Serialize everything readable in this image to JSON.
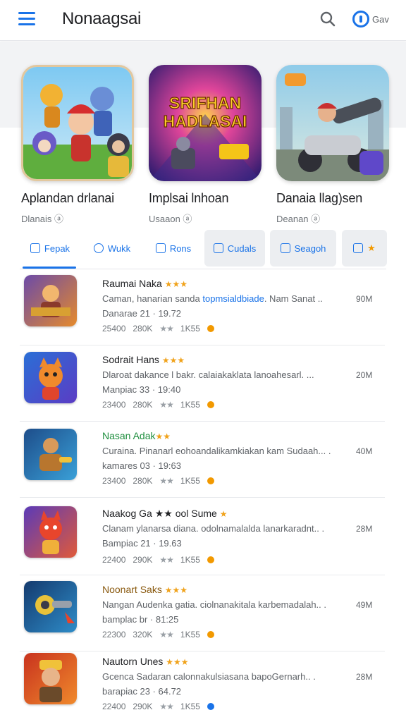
{
  "header": {
    "title": "Nonaagsai",
    "account_label": "Gav"
  },
  "featured": [
    {
      "name": "Aplandan drlanai",
      "sub": "Dlanais ⓐ",
      "art_text_1": "",
      "art_text_2": ""
    },
    {
      "name": "Implsai lnhoan",
      "sub": "Usaaon ⓐ",
      "art_text_1": "SRIFHAN",
      "art_text_2": "HADLASAI"
    },
    {
      "name": "Danaia llag)sen",
      "sub": "Deanan ⓐ",
      "art_text_1": "",
      "art_text_2": ""
    }
  ],
  "tabs": [
    {
      "label": "Fepak"
    },
    {
      "label": "Wukk"
    },
    {
      "label": "Rons"
    },
    {
      "label": "Cudals"
    },
    {
      "label": "Seagoh"
    },
    {
      "label": "★"
    }
  ],
  "list": [
    {
      "title": "Raumai Naka",
      "stars": "★★★",
      "desc_prefix": "Caman, hanarian sanda ",
      "desc_highlight": "topmsialdbiade",
      "desc_suffix": ". Nam Sanat ..",
      "size": "90M",
      "date": "Danarae 21 · 19.72",
      "meta_1": "25400",
      "meta_2": "280K",
      "meta_stars": "★★",
      "meta_3": "1K55",
      "dot_color": "#f29900"
    },
    {
      "title": "Sodrait Hans",
      "stars": "★★★",
      "desc_prefix": "Dlaroat dakance l bakr. calaiakaklata lanoahesarl. ...",
      "desc_highlight": "",
      "desc_suffix": "",
      "size": "20M",
      "date": "Manpiac 33 · 19:40",
      "meta_1": "23400",
      "meta_2": "280K",
      "meta_stars": "★★",
      "meta_3": "1K55",
      "dot_color": "#f29900"
    },
    {
      "title": "Nasan Adak",
      "stars": "★★",
      "desc_prefix": "Curaina. Pinanarl eohoandalikamkiakan kam Sudaah... .",
      "desc_highlight": "",
      "desc_suffix": "",
      "size": "40M",
      "date": "kamares 03 · 19:63",
      "meta_1": "23400",
      "meta_2": "280K",
      "meta_stars": "★★",
      "meta_3": "1K55",
      "dot_color": "#f29900"
    },
    {
      "title": "Naakog Ga ★★ ool Sume",
      "stars": "★",
      "desc_prefix": "Clanam ylanarsa diana. odolnamalalda lanarkaradnt.. .",
      "desc_highlight": "",
      "desc_suffix": "",
      "size": "28M",
      "date": "Bampiac 21 · 19.63",
      "meta_1": "22400",
      "meta_2": "290K",
      "meta_stars": "★★",
      "meta_3": "1K55",
      "dot_color": "#f29900"
    },
    {
      "title": "Noonart Saks",
      "stars": "★★★",
      "desc_prefix": "Nangan Audenka gatia. ciolnanakitala karbemadalah.. .",
      "desc_highlight": "",
      "desc_suffix": "",
      "size": "49M",
      "date": "bamplac br · 81:25",
      "meta_1": "22300",
      "meta_2": "320K",
      "meta_stars": "★★",
      "meta_3": "1K55",
      "dot_color": "#f29900"
    },
    {
      "title": "Nautorn Unes",
      "stars": "★★★",
      "desc_prefix": "Gcenca Sadaran calonnakulsiasana bapoGernarh.. .",
      "desc_highlight": "",
      "desc_suffix": "",
      "size": "28M",
      "date": "barapiac 23 · 64.72",
      "meta_1": "22400",
      "meta_2": "290K",
      "meta_stars": "★★",
      "meta_3": "1K55",
      "dot_color": "#1a73e8"
    }
  ]
}
